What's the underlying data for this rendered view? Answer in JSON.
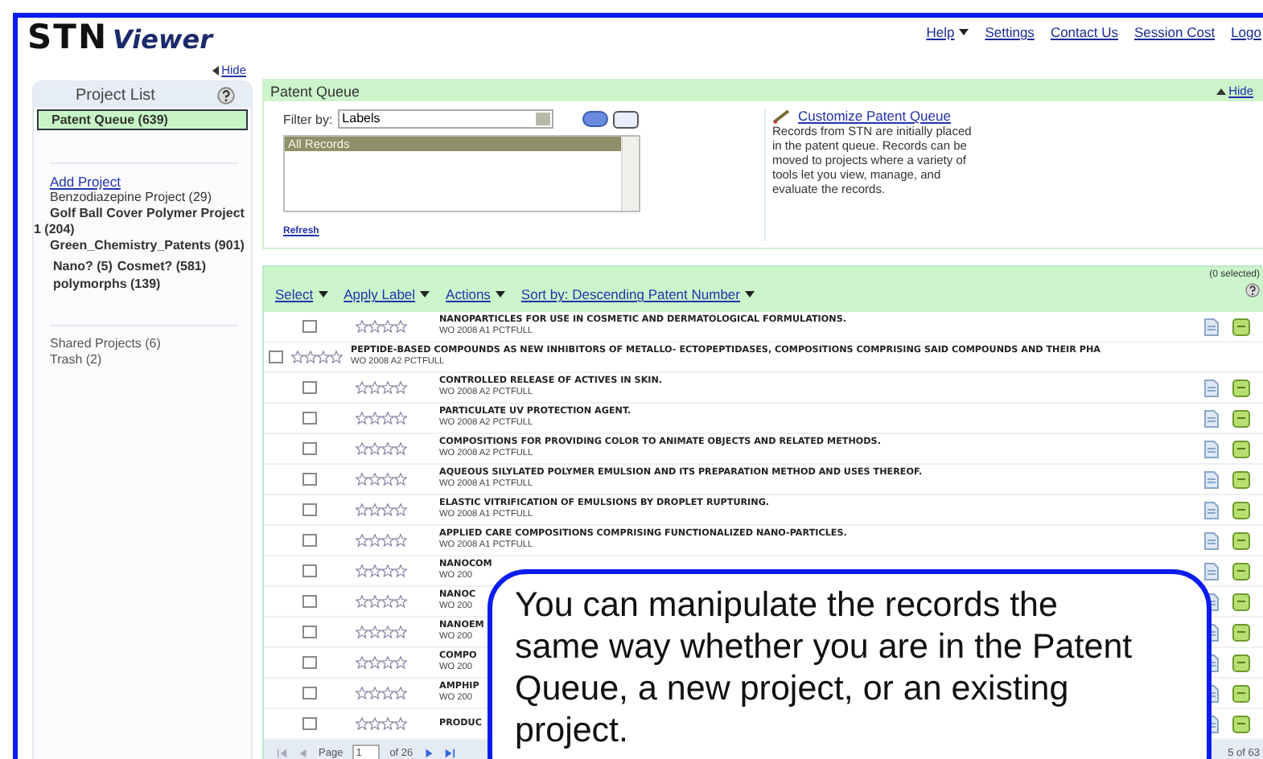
{
  "header": {
    "logo_brand": "STN",
    "logo_product": "Viewer",
    "links": [
      {
        "label": "Help",
        "dropdown": true
      },
      {
        "label": "Settings",
        "dropdown": false
      },
      {
        "label": "Contact Us",
        "dropdown": false
      },
      {
        "label": "Session Cost",
        "dropdown": false
      },
      {
        "label": "Logo",
        "dropdown": false
      }
    ]
  },
  "sidebar": {
    "hide": "Hide",
    "title": "Project List",
    "queue": {
      "label": "Patent Queue (639)",
      "selected": true
    },
    "add_project": "Add Project",
    "projects": [
      {
        "label": "Benzodiazepine Project (29)",
        "bold": false
      },
      {
        "label": "Golf Ball Cover Polymer Project 1 (204)",
        "bold": true
      },
      {
        "label": "Green_Chemistry_Patents (901)",
        "bold": true,
        "children": [
          {
            "label": "Nano? (5)",
            "bold": true
          },
          {
            "label": "Cosmet? (581)",
            "bold": true
          },
          {
            "label": "polymorphs (139)",
            "bold": true
          }
        ]
      }
    ],
    "shared": "Shared Projects (6)",
    "trash": "Trash (2)"
  },
  "queue_panel": {
    "title": "Patent Queue",
    "hide": "Hide",
    "filter_label": "Filter by:",
    "filter_value": "Labels",
    "labels": [
      {
        "label": "All Records",
        "selected": true
      }
    ],
    "refresh": "Refresh",
    "customize": "Customize Patent Queue",
    "description": "Records from STN are initially placed in the patent queue. Records can be moved to projects where a variety of tools let you view, manage, and evaluate the records."
  },
  "records": {
    "toolbar": [
      "Select",
      "Apply Label",
      "Actions",
      "Sort by: Descending Patent Number"
    ],
    "selected_count": "(0 selected)",
    "rows": [
      {
        "kind": "normal",
        "checked": false,
        "stars": 0,
        "title": "NANOPARTICLES FOR USE IN COSMETIC AND DERMATOLOGICAL FORMULATIONS.",
        "source": "WO 2008 A1 PCTFULL"
      },
      {
        "kind": "wide",
        "checked": false,
        "stars": 0,
        "title": "PEPTIDE-BASED COMPOUNDS AS NEW INHIBITORS OF METALLO- ECTOPEPTIDASES, COMPOSITIONS COMPRISING SAID COMPOUNDS AND THEIR PHA",
        "source": "WO 2008 A2 PCTFULL"
      },
      {
        "kind": "normal",
        "checked": false,
        "stars": 0,
        "title": "CONTROLLED RELEASE OF ACTIVES IN SKIN.",
        "source": "WO 2008 A2 PCTFULL"
      },
      {
        "kind": "normal",
        "checked": false,
        "stars": 0,
        "title": "PARTICULATE UV PROTECTION AGENT.",
        "source": "WO 2008 A2 PCTFULL"
      },
      {
        "kind": "normal",
        "checked": false,
        "stars": 0,
        "title": "COMPOSITIONS FOR PROVIDING COLOR TO ANIMATE OBJECTS AND RELATED METHODS.",
        "source": "WO 2008 A2 PCTFULL"
      },
      {
        "kind": "normal",
        "checked": false,
        "stars": 0,
        "title": "AQUEOUS SILYLATED POLYMER EMULSION AND ITS PREPARATION METHOD AND USES THEREOF.",
        "source": "WO 2008 A1 PCTFULL"
      },
      {
        "kind": "normal",
        "checked": false,
        "stars": 0,
        "title": "ELASTIC VITRIFICATION OF EMULSIONS BY DROPLET RUPTURING.",
        "source": "WO 2008 A1 PCTFULL"
      },
      {
        "kind": "normal",
        "checked": false,
        "stars": 0,
        "title": "APPLIED CARE COMPOSITIONS COMPRISING FUNCTIONALIZED NANO-PARTICLES.",
        "source": "WO 2008 A1 PCTFULL"
      },
      {
        "kind": "normal",
        "checked": false,
        "stars": 0,
        "title": "NANOCOM",
        "source": "WO 200"
      },
      {
        "kind": "normal",
        "checked": false,
        "stars": 0,
        "title": "NANOC",
        "source": "WO 200"
      },
      {
        "kind": "normal",
        "checked": false,
        "stars": 0,
        "title": "NANOEM",
        "source": "WO 200"
      },
      {
        "kind": "normal",
        "checked": false,
        "stars": 0,
        "title": "COMPO",
        "source": "WO 200"
      },
      {
        "kind": "normal",
        "checked": false,
        "stars": 0,
        "title": "AMPHIP",
        "source": "WO 200"
      },
      {
        "kind": "normal",
        "checked": false,
        "stars": 0,
        "title": "PRODUC"
      }
    ],
    "pager": {
      "page_label": "Page",
      "page": "1",
      "of": "of 26",
      "range": "5 of 63"
    }
  },
  "callout": {
    "text": "You can manipulate the records the same way whether you are in the Patent Queue, a new project, or an existing project."
  }
}
